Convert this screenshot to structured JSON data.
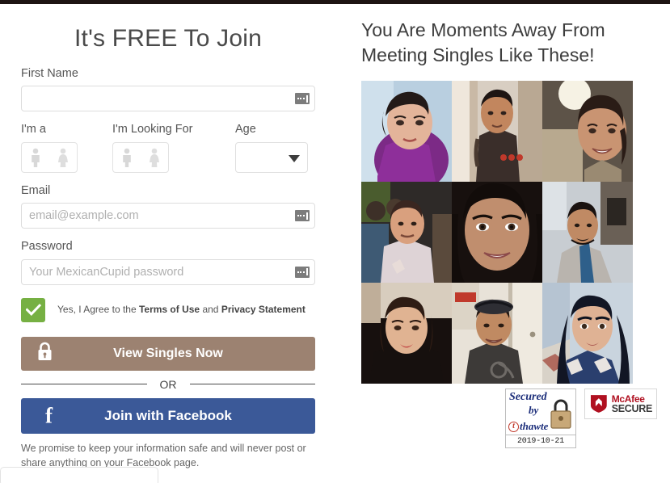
{
  "form": {
    "title": "It's FREE To Join",
    "first_name": {
      "label": "First Name",
      "value": "",
      "placeholder": ""
    },
    "gender_self": {
      "label": "I'm a",
      "options": [
        "male",
        "female"
      ],
      "selected": ""
    },
    "gender_seeking": {
      "label": "I'm Looking For",
      "options": [
        "male",
        "female"
      ],
      "selected": ""
    },
    "age": {
      "label": "Age",
      "value": "",
      "options": []
    },
    "email": {
      "label": "Email",
      "value": "",
      "placeholder": "email@example.com"
    },
    "password": {
      "label": "Password",
      "value": "",
      "placeholder": "Your MexicanCupid password"
    },
    "agreement": {
      "checked": true,
      "prefix": "Yes, I Agree to the ",
      "terms_link": "Terms of Use",
      "middle": " and ",
      "privacy_link": "Privacy Statement"
    },
    "cta_label": "View Singles Now",
    "cta_icon": "lock-icon",
    "divider_label": "OR",
    "facebook_label": "Join with Facebook",
    "facebook_icon": "facebook-f-icon",
    "promise_text": "We promise to keep your information safe and will never post or share anything on your Facebook page."
  },
  "promo": {
    "headline": "You Are Moments Away From Meeting Singles Like These!",
    "photos": [
      {
        "alt": "member-photo-1"
      },
      {
        "alt": "member-photo-2"
      },
      {
        "alt": "member-photo-3"
      },
      {
        "alt": "member-photo-4"
      },
      {
        "alt": "member-photo-5"
      },
      {
        "alt": "member-photo-6"
      },
      {
        "alt": "member-photo-7"
      },
      {
        "alt": "member-photo-8"
      },
      {
        "alt": "member-photo-9"
      }
    ]
  },
  "badges": {
    "thawte": {
      "line1": "Secured",
      "line2": "by",
      "mark": "t",
      "brand": "thawte",
      "date": "2019-10-21"
    },
    "mcafee": {
      "line1": "McAfee",
      "line2": "SECURE"
    }
  },
  "colors": {
    "cta": "#9c8271",
    "facebook": "#3b5998",
    "checkbox": "#76b043",
    "thawte_blue": "#1b2d7a",
    "mcafee_red": "#b01020"
  }
}
